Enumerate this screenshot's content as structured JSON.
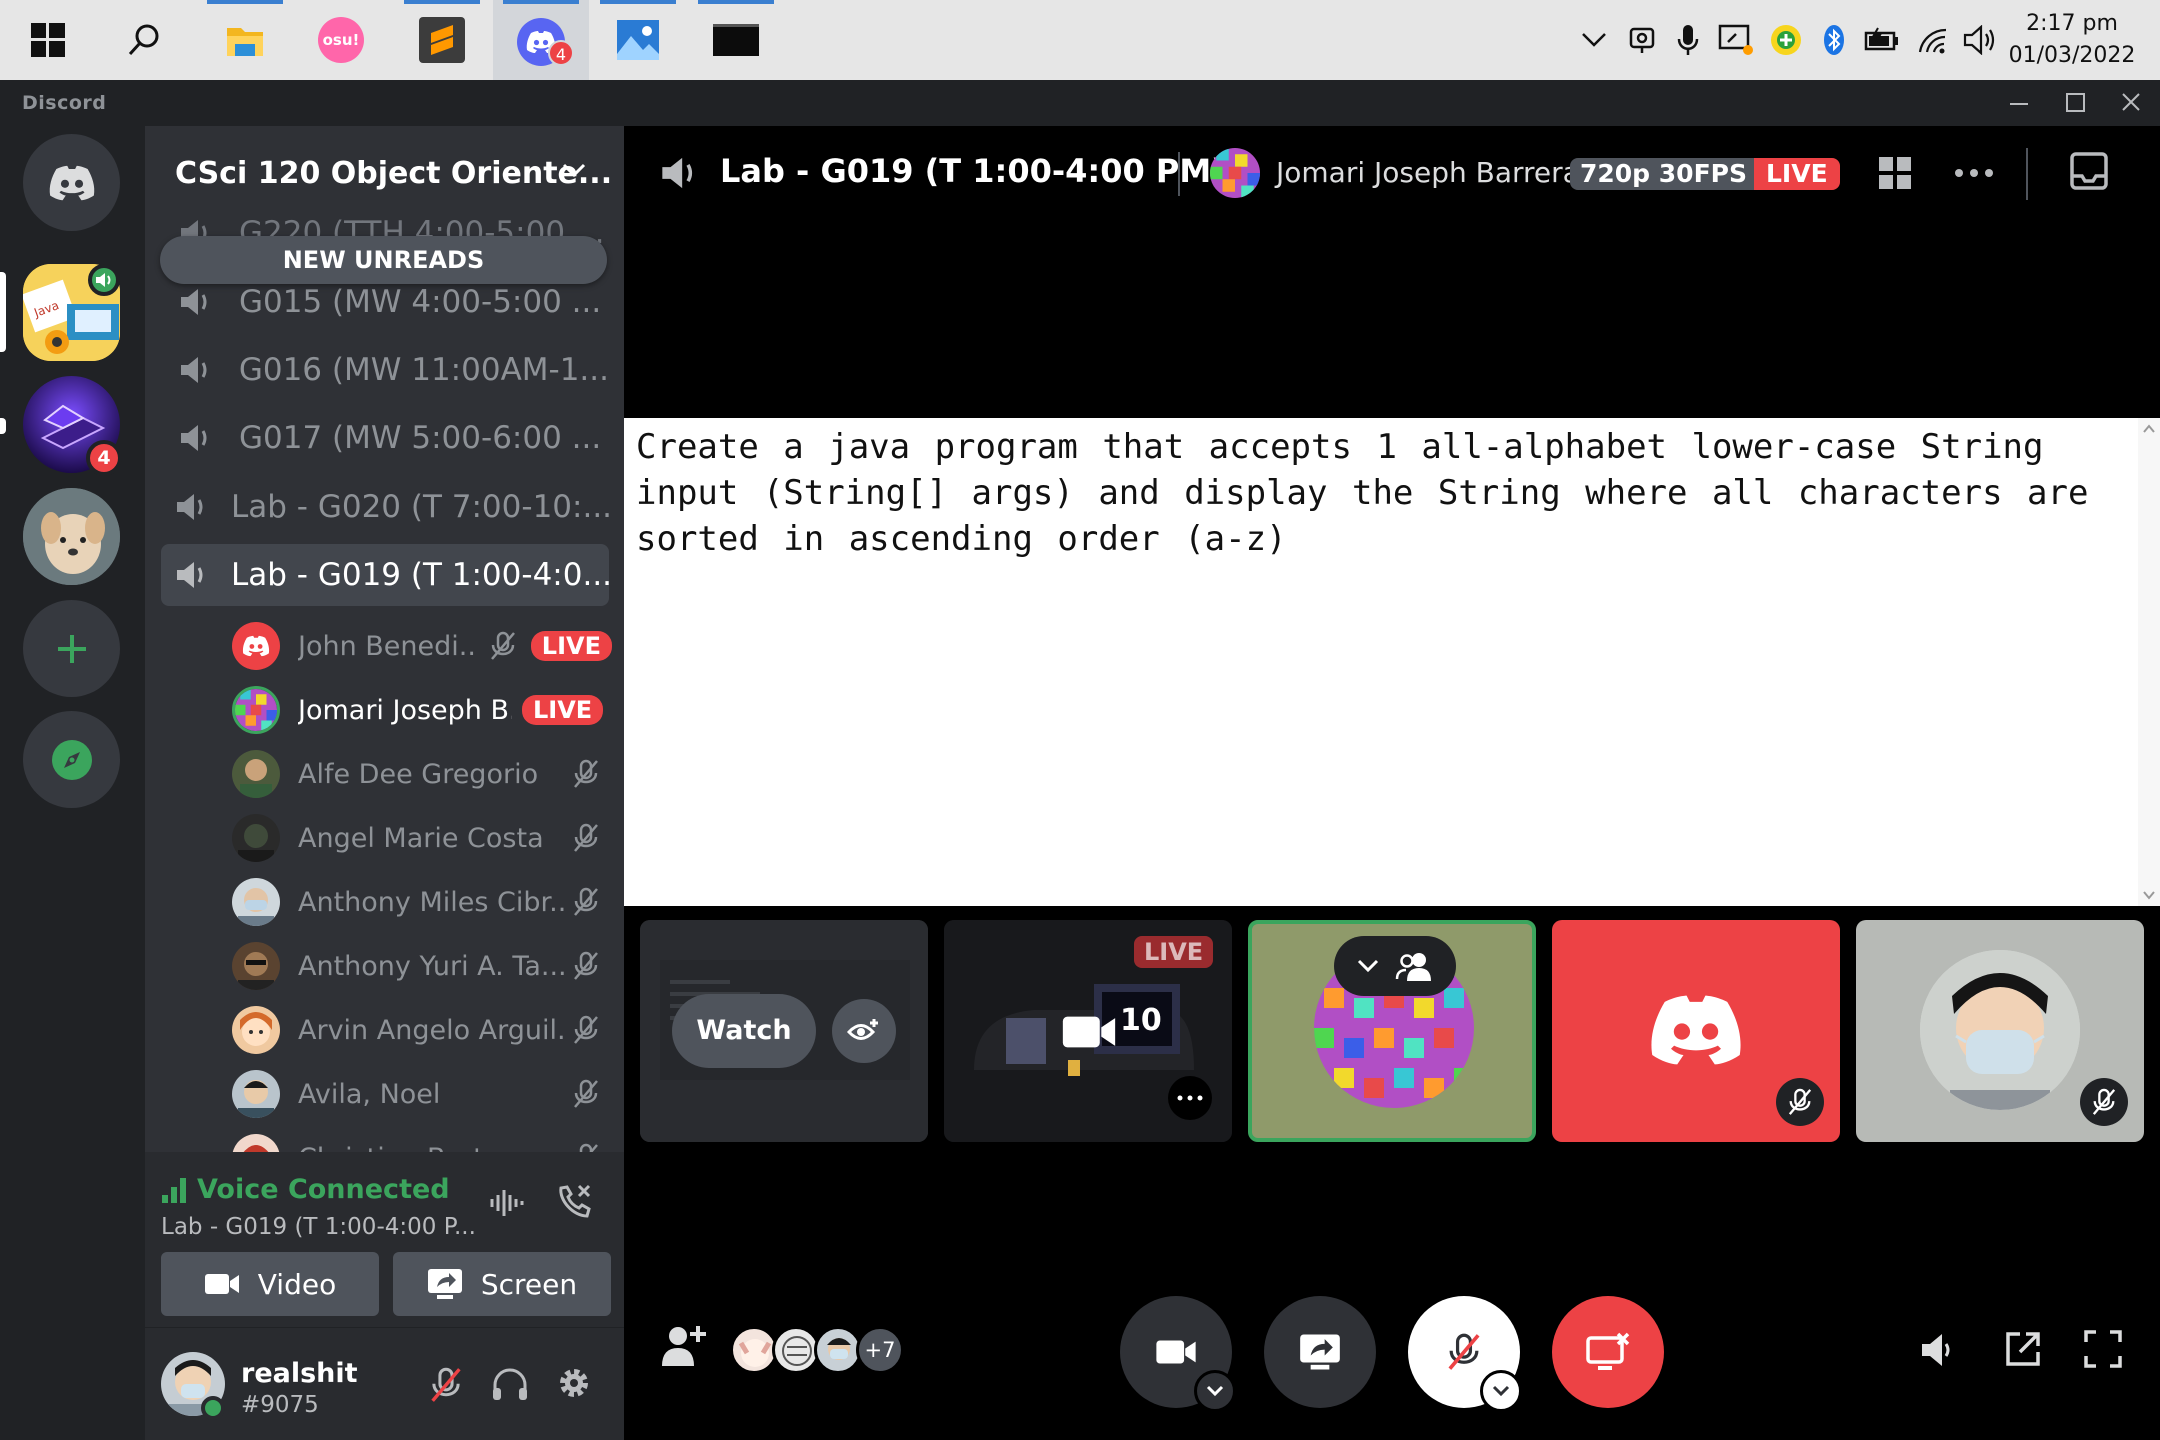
{
  "taskbar": {
    "apps": [
      "start-icon",
      "search-icon",
      "file-explorer-icon",
      "osu-icon",
      "sublime-icon",
      "discord-icon",
      "photos-icon",
      "terminal-icon"
    ],
    "osu_label": "osu!",
    "discord_badge": "4",
    "clock": {
      "time": "2:17 pm",
      "date": "01/03/2022"
    }
  },
  "window": {
    "brand": "Discord"
  },
  "guilds": {
    "server_badge": "4"
  },
  "server": {
    "name": "CSci 120 Object Oriente...",
    "new_unreads": "NEW UNREADS",
    "channels": [
      {
        "name": "G220 (TTH 4:00-5:00 ..."
      },
      {
        "name": "G015 (MW 4:00-5:00 ..."
      },
      {
        "name": "G016 (MW 11:00AM-1..."
      },
      {
        "name": "G017 (MW 5:00-6:00 ..."
      },
      {
        "name": "Lab - G020 (T 7:00-10:..."
      },
      {
        "name": "Lab - G019 (T 1:00-4:0..."
      }
    ],
    "voice_users": [
      {
        "name": "John Benedi...",
        "live": "LIVE"
      },
      {
        "name": "Jomari Joseph B...",
        "live": "LIVE"
      },
      {
        "name": "Alfe Dee Gregorio"
      },
      {
        "name": "Angel Marie Costa"
      },
      {
        "name": "Anthony Miles Cibr..."
      },
      {
        "name": "Anthony Yuri A. Ta..."
      },
      {
        "name": "Arvin Angelo Arguil..."
      },
      {
        "name": "Avila, Noel"
      },
      {
        "name": "Christian Barte..."
      }
    ]
  },
  "voice": {
    "status": "Voice Connected",
    "channel": "Lab - G019 (T 1:00-4:00 P...",
    "video_label": "Video",
    "screen_label": "Screen"
  },
  "user": {
    "name": "realshit",
    "tag": "#9075"
  },
  "call": {
    "title": "Lab - G019 (T 1:00-4:00 PM)",
    "streamer": "Jomari Joseph Barrera",
    "quality": "720p 30FPS",
    "live": "LIVE",
    "stream_text": "Create a java program that accepts 1 all-alphabet lower-case String input (String[] args) and display the String where all characters are sorted in ascending order (a-z)",
    "watch_label": "Watch",
    "tile_live": "LIVE",
    "participants_extra": "+7"
  },
  "colors": {
    "blurple": "#5865f2",
    "red": "#ed4245",
    "green": "#3ba55d",
    "bg_dark": "#202225"
  }
}
